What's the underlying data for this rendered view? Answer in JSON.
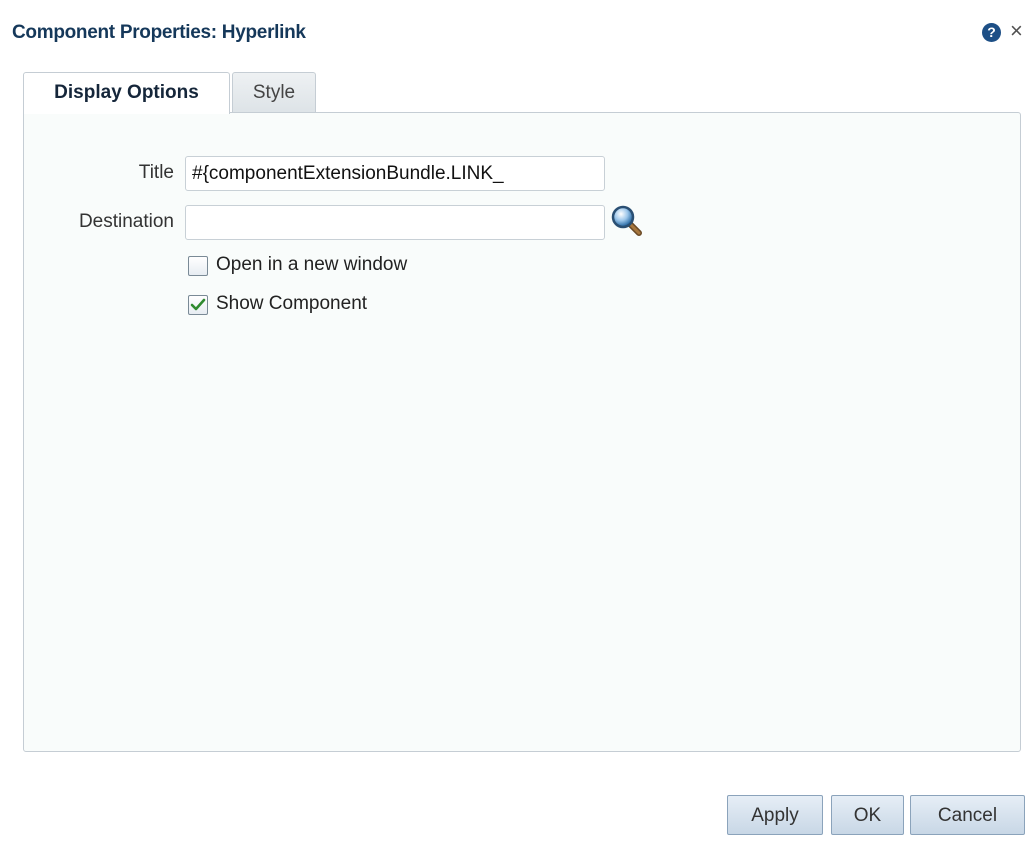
{
  "dialog": {
    "title": "Component Properties: Hyperlink",
    "help_icon": "help-icon",
    "close_icon": "close-icon",
    "close_glyph": "×",
    "help_glyph": "?"
  },
  "tabs": [
    {
      "label": "Display Options",
      "active": true
    },
    {
      "label": "Style",
      "active": false
    }
  ],
  "form": {
    "title_label": "Title",
    "title_value": "#{componentExtensionBundle.LINK_",
    "destination_label": "Destination",
    "destination_value": "",
    "search_icon": "magnifier-icon",
    "open_new_window_label": "Open in a new window",
    "open_new_window_checked": false,
    "show_component_label": "Show Component",
    "show_component_checked": true
  },
  "buttons": {
    "apply": "Apply",
    "ok": "OK",
    "cancel": "Cancel"
  },
  "colors": {
    "title": "#15385a",
    "button_border": "#8ba3bb",
    "check_green": "#2f8a2f",
    "panel_bg": "#f9fcfb"
  }
}
